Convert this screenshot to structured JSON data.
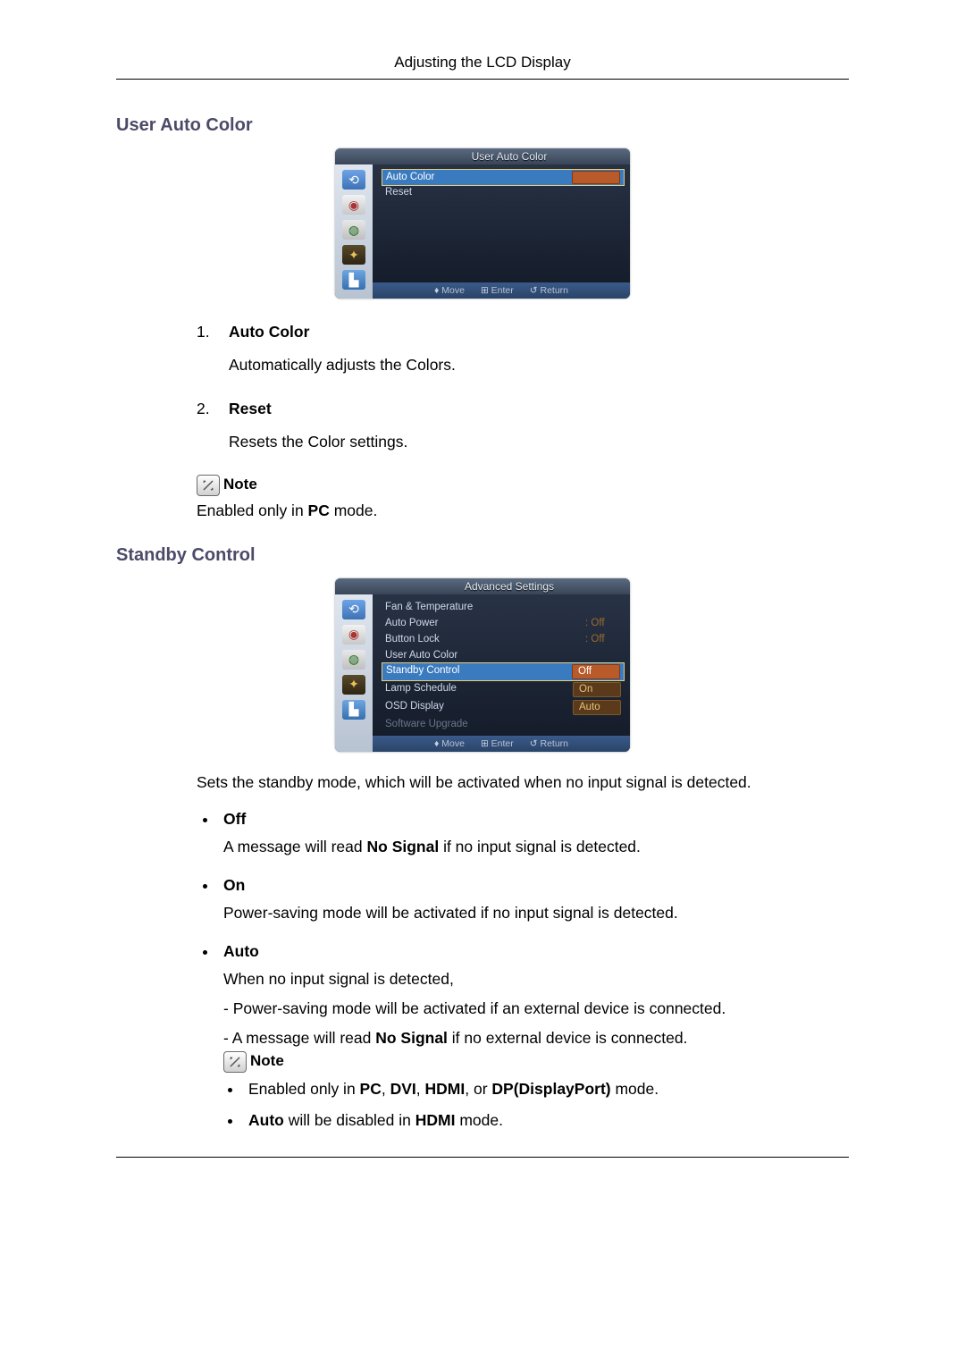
{
  "header": "Adjusting the LCD Display",
  "section1": {
    "title": "User Auto Color",
    "osd": {
      "title": "User Auto Color",
      "items": [
        "Auto Color",
        "Reset"
      ],
      "nav": {
        "move": "Move",
        "enter": "Enter",
        "return": "Return"
      }
    },
    "list": [
      {
        "title": "Auto Color",
        "desc": "Automatically adjusts the Colors."
      },
      {
        "title": "Reset",
        "desc": "Resets the Color settings."
      }
    ],
    "note_label": "Note",
    "note_text_pre": "Enabled only in ",
    "note_text_bold": "PC",
    "note_text_post": " mode."
  },
  "section2": {
    "title": "Standby Control",
    "osd": {
      "title": "Advanced Settings",
      "rows": [
        {
          "label": "Fan & Temperature",
          "val": ""
        },
        {
          "label": "Auto Power",
          "val": ": Off"
        },
        {
          "label": "Button Lock",
          "val": ": Off"
        },
        {
          "label": "User Auto Color",
          "val": ""
        },
        {
          "label": "Standby Control",
          "val": "Off"
        },
        {
          "label": "Lamp Schedule",
          "val": "On"
        },
        {
          "label": "OSD Display",
          "val": "Auto"
        },
        {
          "label": "Software Upgrade",
          "val": ""
        }
      ],
      "nav": {
        "move": "Move",
        "enter": "Enter",
        "return": "Return"
      }
    },
    "intro": "Sets the standby mode, which will be activated when no input signal is detected.",
    "options": [
      {
        "title": "Off",
        "lines": [
          {
            "pre": "A message will read ",
            "bold": "No Signal",
            "post": " if no input signal is detected."
          }
        ]
      },
      {
        "title": "On",
        "lines": [
          {
            "pre": "Power-saving mode will be activated if no input signal is detected.",
            "bold": "",
            "post": ""
          }
        ]
      },
      {
        "title": "Auto",
        "lines": [
          {
            "pre": "When no input signal is detected,",
            "bold": "",
            "post": ""
          },
          {
            "pre": "- Power-saving mode will be activated if an external device is connected.",
            "bold": "",
            "post": ""
          },
          {
            "pre": "- A message will read ",
            "bold": "No Signal",
            "post": " if no external device is connected."
          }
        ]
      }
    ],
    "note_label": "Note",
    "notes": [
      {
        "pre": "Enabled only in ",
        "bolds": [
          "PC",
          "DVI",
          "HDMI",
          "DP(DisplayPort)"
        ],
        "sep": ", ",
        "last_sep": ", or ",
        "post": " mode."
      },
      {
        "pre": "",
        "bold1": "Auto",
        "mid": " will be disabled in ",
        "bold2": "HDMI",
        "post": " mode."
      }
    ]
  }
}
